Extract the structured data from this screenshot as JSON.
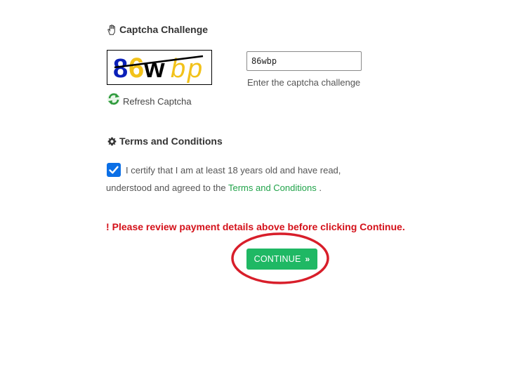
{
  "captcha": {
    "title": "Captcha Challenge",
    "title_icon": "hand-icon",
    "image_text": "86wbp",
    "input_value": "86wbp",
    "help_text": "Enter the captcha challenge",
    "refresh_label": "Refresh Captcha",
    "refresh_icon": "refresh-icon"
  },
  "terms": {
    "title": "Terms and Conditions",
    "title_icon": "gear-icon",
    "checked": true,
    "text_line1": "I certify that I am at least 18 years old and have read,",
    "text_line2_prefix": "understood and agreed to the",
    "link_text": "Terms and Conditions",
    "text_line2_suffix": "."
  },
  "warning": {
    "icon": "!",
    "text": "Please review payment details above before clicking Continue."
  },
  "continue_button": {
    "label": "CONTINUE",
    "chevron": "»"
  },
  "colors": {
    "accent_green": "#1fb864",
    "link_green": "#21a34a",
    "warning_red": "#d4111a",
    "checkbox_blue": "#0b6fe6",
    "highlight_red": "#d81e2a"
  }
}
